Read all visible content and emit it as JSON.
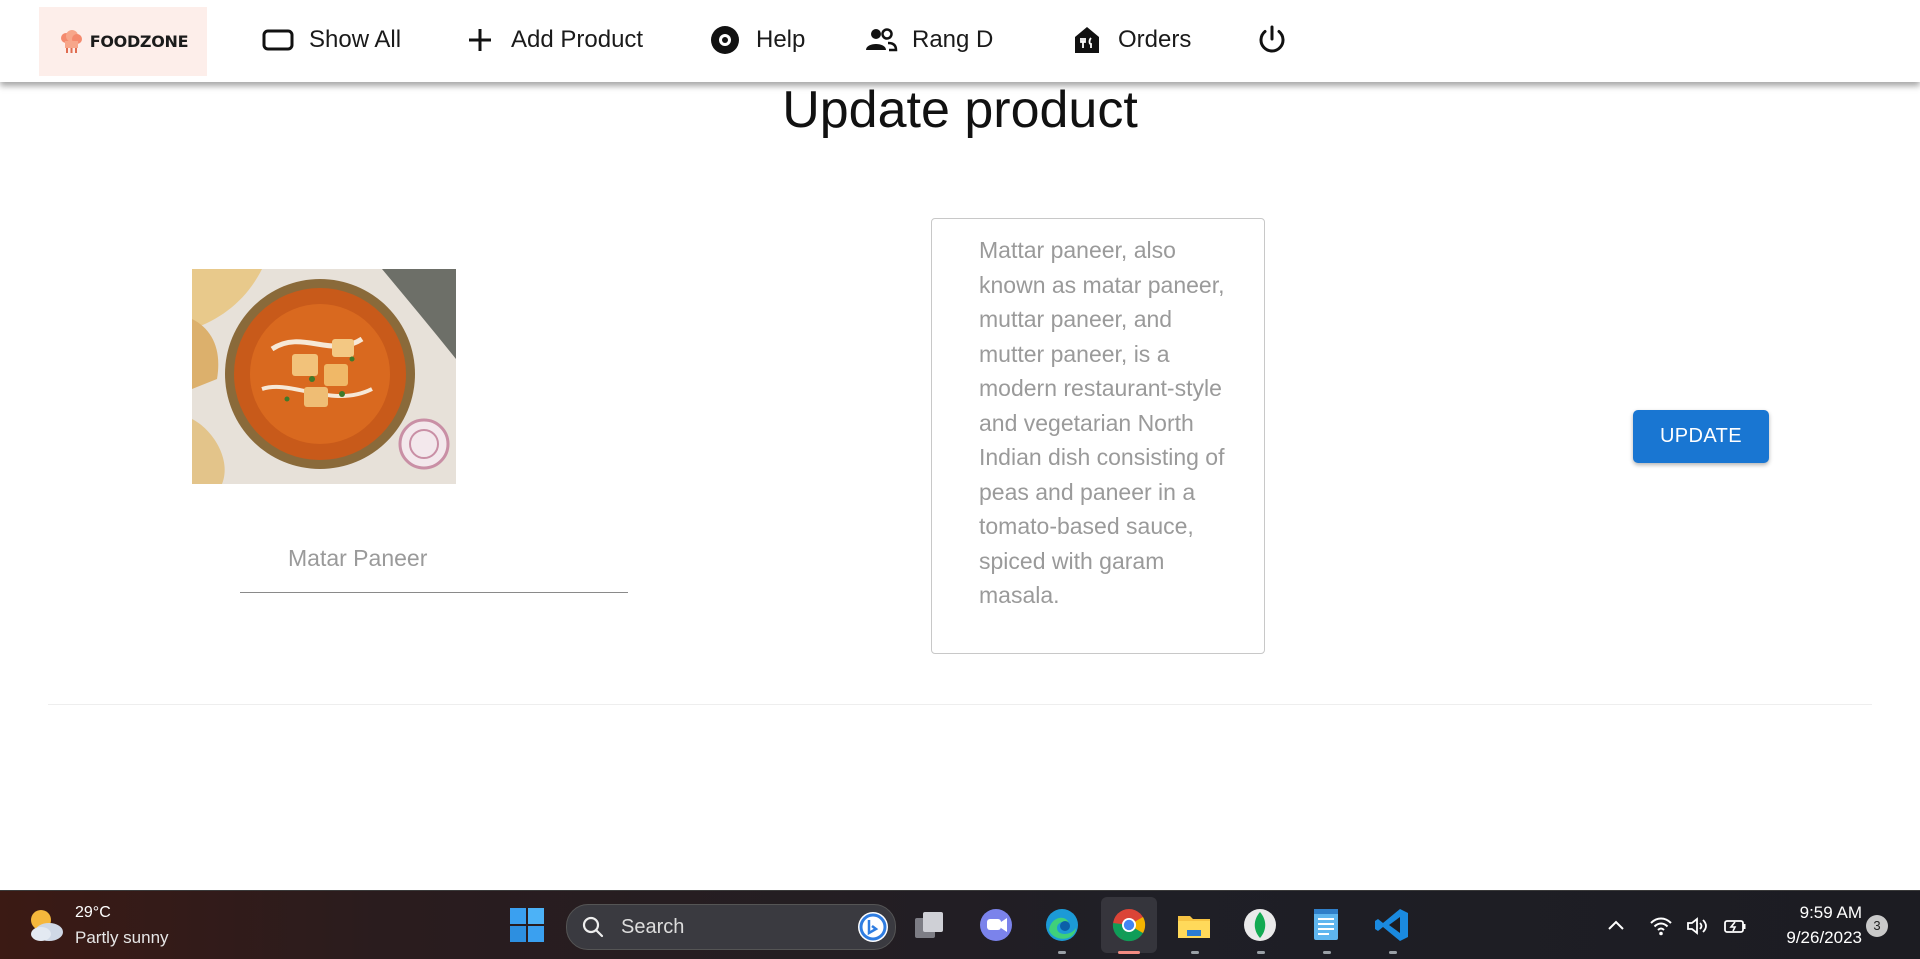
{
  "brand": {
    "name": "FOODZONE"
  },
  "nav": {
    "show_all": "Show All",
    "add_product": "Add Product",
    "help": "Help",
    "user": "Rang D",
    "orders": "Orders"
  },
  "page": {
    "title": "Update product",
    "product_name_placeholder": "Matar Paneer",
    "product_name_value": "",
    "description": "Mattar paneer, also known as matar paneer, muttar paneer, and mutter paneer, is a modern restaurant-style and vegetarian North Indian dish consisting of peas and paneer in a tomato-based sauce, spiced with garam masala.",
    "update_label": "UPDATE"
  },
  "taskbar": {
    "weather_temp": "29°C",
    "weather_cond": "Partly sunny",
    "search_label": "Search",
    "time": "9:59 AM",
    "date": "9/26/2023",
    "notification_count": "3",
    "apps": [
      "windows-start",
      "task-view",
      "teams",
      "edge",
      "chrome",
      "file-explorer",
      "mongodb-compass",
      "notepad",
      "vs-code"
    ]
  },
  "colors": {
    "accent": "#1976d2",
    "logo_bg": "#fdeeea",
    "placeholder": "#9a9a9a"
  }
}
